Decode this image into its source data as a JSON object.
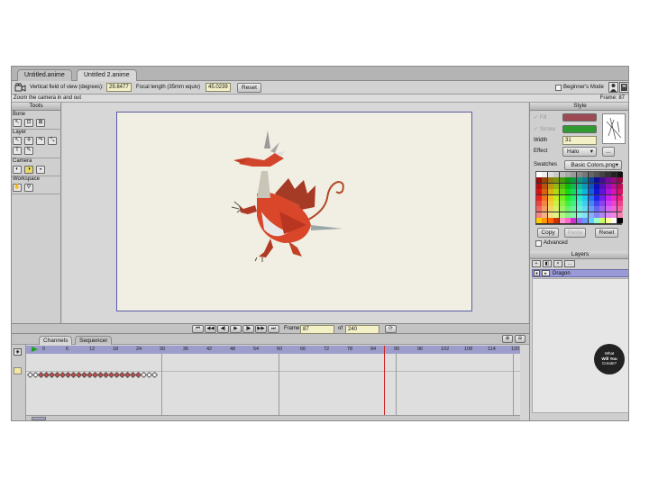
{
  "tabs": [
    {
      "label": "Untitled.anime",
      "active": false
    },
    {
      "label": "Untitled 2.anime",
      "active": true
    }
  ],
  "toolbar": {
    "fov_label": "Vertical field of view (degrees):",
    "fov_value": "29.8477",
    "focal_label": "Focal length (35mm equiv)",
    "focal_value": "45.0239",
    "reset_label": "Reset",
    "beginners_mode_label": "Beginner's Mode",
    "beginners_mode_checked": false
  },
  "status": {
    "hint": "Zoom the camera in and out",
    "frame_label": "Frame: 87"
  },
  "tools": {
    "title": "Tools",
    "sections": [
      {
        "label": "Bone",
        "icons": [
          "bone-select-icon",
          "bone-translate-icon",
          "bone-rotate-icon"
        ]
      },
      {
        "label": "Layer",
        "icons": [
          "layer-select-icon",
          "layer-move-icon",
          "layer-rotate-icon",
          "layer-scale-icon",
          "layer-text-icon",
          "layer-pick-icon"
        ]
      },
      {
        "label": "Camera",
        "icons": [
          "camera-zoom-icon",
          "camera-roll-icon",
          "camera-pan-icon"
        ]
      },
      {
        "label": "Workspace",
        "icons": [
          "hand-icon",
          "magnify-icon"
        ]
      }
    ]
  },
  "style": {
    "title": "Style",
    "fill_label": "Fill",
    "stroke_label": "Stroke",
    "fill_color": "#9e4a55",
    "stroke_color": "#2f9a2f",
    "width_label": "Width",
    "width_value": "31",
    "effect_label": "Effect",
    "effect_value": "Halo",
    "effect_more": "...",
    "swatches_label": "Swatches",
    "swatches_value": "Basic Colors.png",
    "copy_label": "Copy",
    "paste_label": "Paste",
    "reset_label": "Reset",
    "advanced_label": "Advanced",
    "advanced_checked": false
  },
  "layers": {
    "title": "Layers",
    "toolbar_more": "...",
    "items": [
      {
        "name": "Dragon",
        "selected": true
      }
    ]
  },
  "transport": {
    "frame_label": "Frame",
    "frame_value": "87",
    "of_label": "of",
    "total_value": "240"
  },
  "timeline": {
    "tabs": [
      "Channels",
      "Sequencer"
    ],
    "active_tab": "Channels",
    "ruler": [
      "0",
      "6",
      "12",
      "18",
      "24",
      "30",
      "36",
      "42",
      "48",
      "54",
      "60",
      "66",
      "72",
      "78",
      "84",
      "90",
      "96",
      "102",
      "108",
      "114",
      "120"
    ],
    "current_frame": 87
  },
  "badge": {
    "line1": "What",
    "line2": "Will You",
    "line3": "Create?"
  },
  "colors": {
    "canvas_bg": "#f1efe3",
    "playhead": "#d02020",
    "layer_selected": "#9a9ad8",
    "ruler_bg": "#9d9dcb"
  }
}
